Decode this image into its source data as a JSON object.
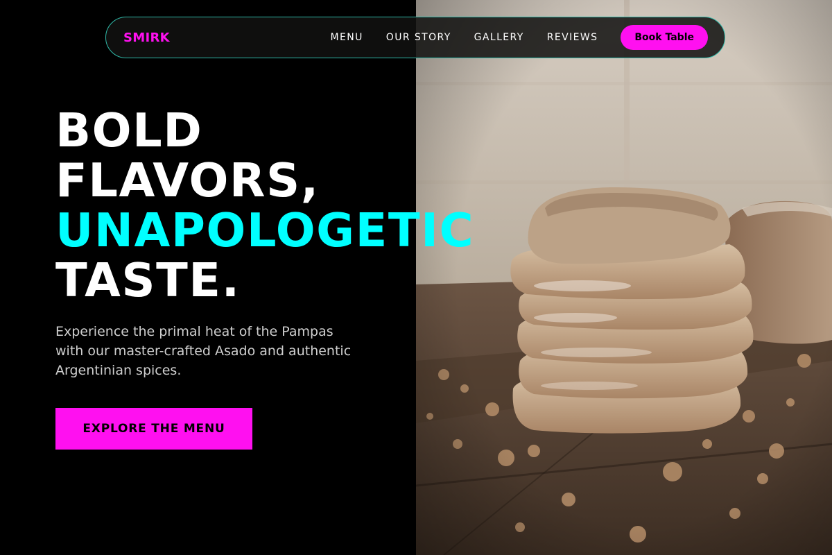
{
  "brand": {
    "name": "SMIRK",
    "color": "#ff10f0"
  },
  "nav": {
    "links": [
      {
        "label": "MENU"
      },
      {
        "label": "OUR STORY"
      },
      {
        "label": "GALLERY"
      },
      {
        "label": "REVIEWS"
      }
    ],
    "cta_label": "Book Table",
    "border_color": "#2fb9a8"
  },
  "hero": {
    "headline": {
      "line1": "BOLD",
      "line2": "FLAVORS,",
      "line3": "UNAPOLOGETIC",
      "line4": "TASTE."
    },
    "accent_color": "#00ffff",
    "subtext": "Experience the primal heat of the Pampas with our master-crafted Asado and authentic Argentinian spices.",
    "cta_label": "EXPLORE THE MENU",
    "image_icon": "bread-stack-photo"
  },
  "colors": {
    "background": "#000000",
    "primary": "#ff10f0",
    "accent": "#00ffff",
    "text": "#ffffff",
    "muted_text": "#cfcfcf"
  }
}
